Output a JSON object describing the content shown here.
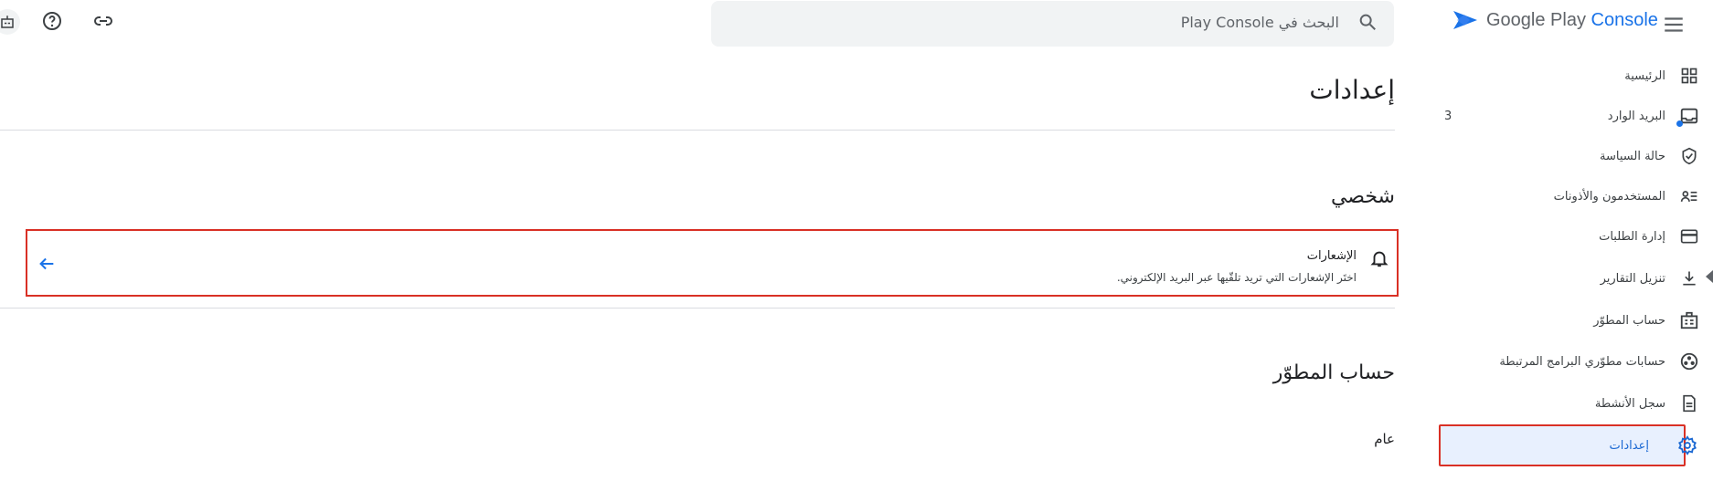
{
  "header": {
    "logo_prefix": "Google Play",
    "logo_suffix": "Console",
    "search_placeholder": "البحث في Play Console"
  },
  "sidebar": {
    "items": [
      {
        "label": "الرئيسية",
        "icon": "grid-icon"
      },
      {
        "label": "البريد الوارد",
        "icon": "inbox-icon",
        "badge": "3"
      },
      {
        "label": "حالة السياسة",
        "icon": "shield-icon"
      },
      {
        "label": "المستخدمون والأذونات",
        "icon": "users-permissions-icon"
      },
      {
        "label": "إدارة الطلبات",
        "icon": "credit-card-icon"
      },
      {
        "label": "تنزيل التقارير",
        "icon": "download-icon"
      },
      {
        "label": "حساب المطوّر",
        "icon": "developer-account-icon"
      },
      {
        "label": "حسابات مطوّري البرامج المرتبطة",
        "icon": "linked-accounts-icon"
      },
      {
        "label": "سجل الأنشطة",
        "icon": "document-icon"
      },
      {
        "label": "إعدادات",
        "icon": "gear-icon",
        "active": true
      }
    ]
  },
  "main": {
    "title": "إعدادات",
    "personal_section": "شخصي",
    "notifications": {
      "title": "الإشعارات",
      "description": "اختَر الإشعارات التي تريد تلقّيها عبر البريد الإلكتروني."
    },
    "developer_section": "حساب المطوّر",
    "general_label": "عام"
  },
  "colors": {
    "accent": "#1a73e8",
    "active_bg": "#e8f0fe",
    "highlight_border": "#d93025"
  }
}
